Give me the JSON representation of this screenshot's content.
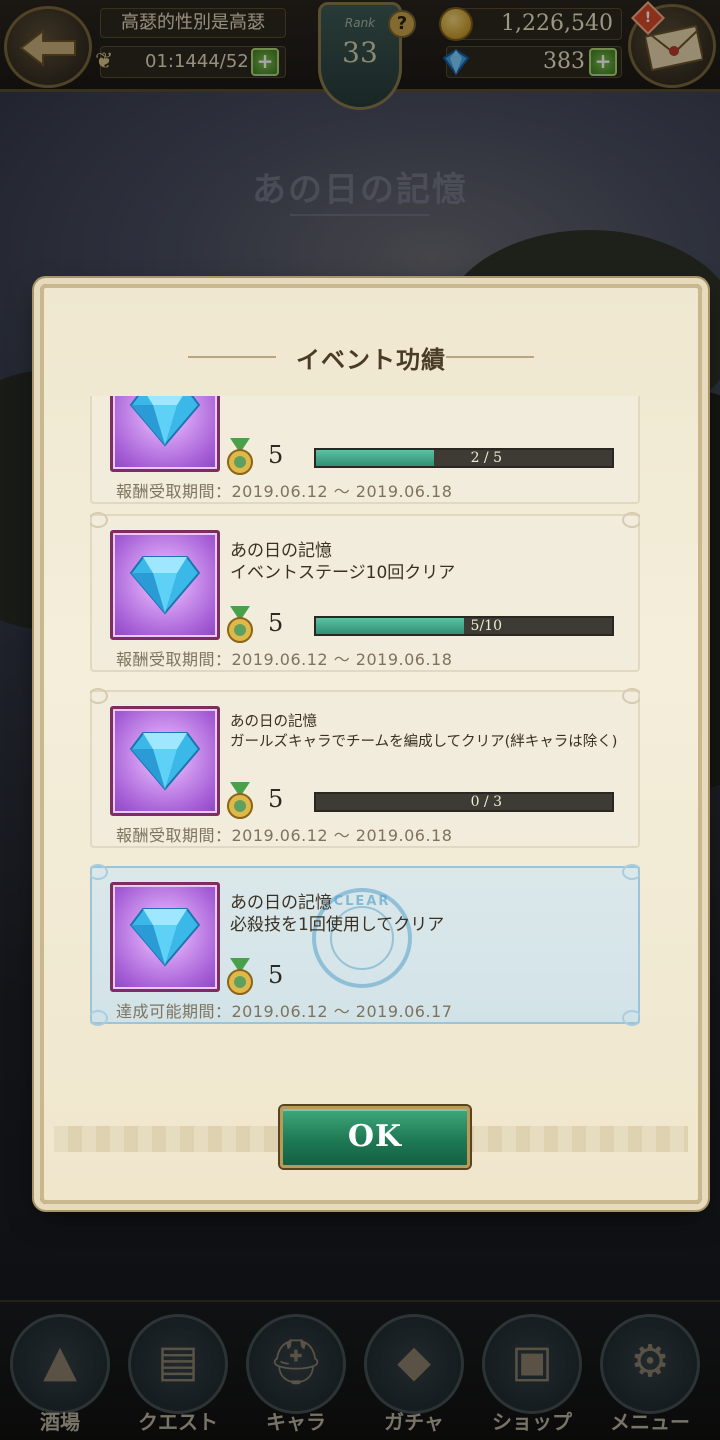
{
  "background": {
    "screen_title": "あの日の記憶"
  },
  "header": {
    "player_name": "高瑟的性別是高瑟",
    "stamina": "01:1444/52",
    "rank_label": "Rank",
    "rank_value": "33",
    "gold": "1,226,540",
    "gems": "383"
  },
  "dialog": {
    "title": "イベント功績",
    "ok_label": "OK",
    "achievements": [
      {
        "title": "",
        "description": "",
        "reward_count": "5",
        "progress_text": "2 / 5",
        "progress": 0.4,
        "period": "報酬受取期間：2019.06.12 ～ 2019.06.18",
        "cleared": false
      },
      {
        "title": "あの日の記憶",
        "description": "イベントステージ10回クリア",
        "reward_count": "5",
        "progress_text": "5/10",
        "progress": 0.5,
        "period": "報酬受取期間：2019.06.12 ～ 2019.06.18",
        "cleared": false
      },
      {
        "title": "あの日の記憶",
        "description": "ガールズキャラでチームを編成してクリア(絆キャラは除く)",
        "reward_count": "5",
        "progress_text": "0 / 3",
        "progress": 0,
        "period": "報酬受取期間：2019.06.12 ～ 2019.06.18",
        "cleared": false
      },
      {
        "title": "あの日の記憶",
        "description": "必殺技を1回使用してクリア",
        "reward_count": "5",
        "period": "達成可能期間：2019.06.12 ～ 2019.06.17",
        "cleared": true,
        "stamp_text": "CLEAR"
      }
    ]
  },
  "bottom_nav": {
    "items": [
      {
        "label": "酒場",
        "icon": "tavern-icon"
      },
      {
        "label": "クエスト",
        "icon": "quest-scroll-icon"
      },
      {
        "label": "キャラ",
        "icon": "helmet-icon"
      },
      {
        "label": "ガチャ",
        "icon": "crystal-icon"
      },
      {
        "label": "ショップ",
        "icon": "shop-sign-icon"
      },
      {
        "label": "メニュー",
        "icon": "gear-icon"
      }
    ]
  },
  "colors": {
    "accent_green": "#2f8f74",
    "progress_track": "#3e3b34",
    "parchment": "#f2ecdc",
    "cleared_card": "#d2e3e8"
  }
}
